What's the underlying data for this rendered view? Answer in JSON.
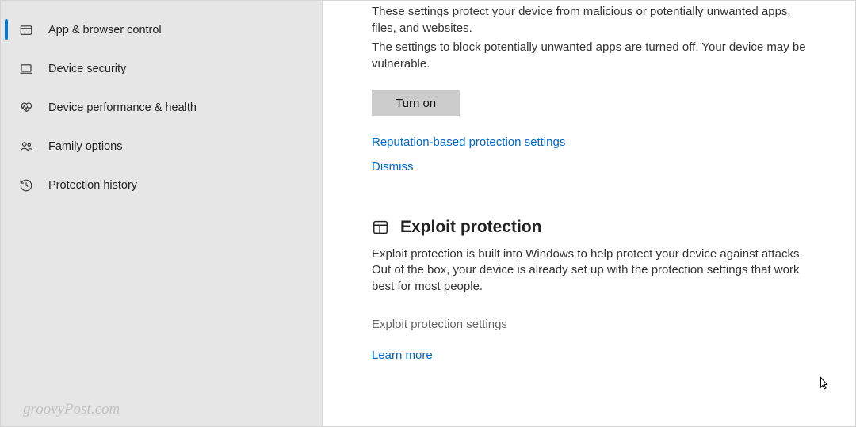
{
  "sidebar": {
    "items": [
      {
        "label": "App & browser control",
        "icon": "window-icon",
        "selected": true
      },
      {
        "label": "Device security",
        "icon": "laptop-icon",
        "selected": false
      },
      {
        "label": "Device performance & health",
        "icon": "heart-pulse-icon",
        "selected": false
      },
      {
        "label": "Family options",
        "icon": "people-icon",
        "selected": false
      },
      {
        "label": "Protection history",
        "icon": "history-icon",
        "selected": false
      }
    ]
  },
  "reputation": {
    "description1": "These settings protect your device from malicious or potentially unwanted apps, files, and websites.",
    "description2": "The settings to block potentially unwanted apps are turned off. Your device may be vulnerable.",
    "button_label": "Turn on",
    "settings_link": "Reputation-based protection settings",
    "dismiss_link": "Dismiss"
  },
  "exploit": {
    "heading": "Exploit protection",
    "description": "Exploit protection is built into Windows to help protect your device against attacks.  Out of the box, your device is already set up with the protection settings that work best for most people.",
    "settings_link": "Exploit protection settings",
    "learn_more": "Learn more"
  },
  "watermark": "groovyPost.com"
}
